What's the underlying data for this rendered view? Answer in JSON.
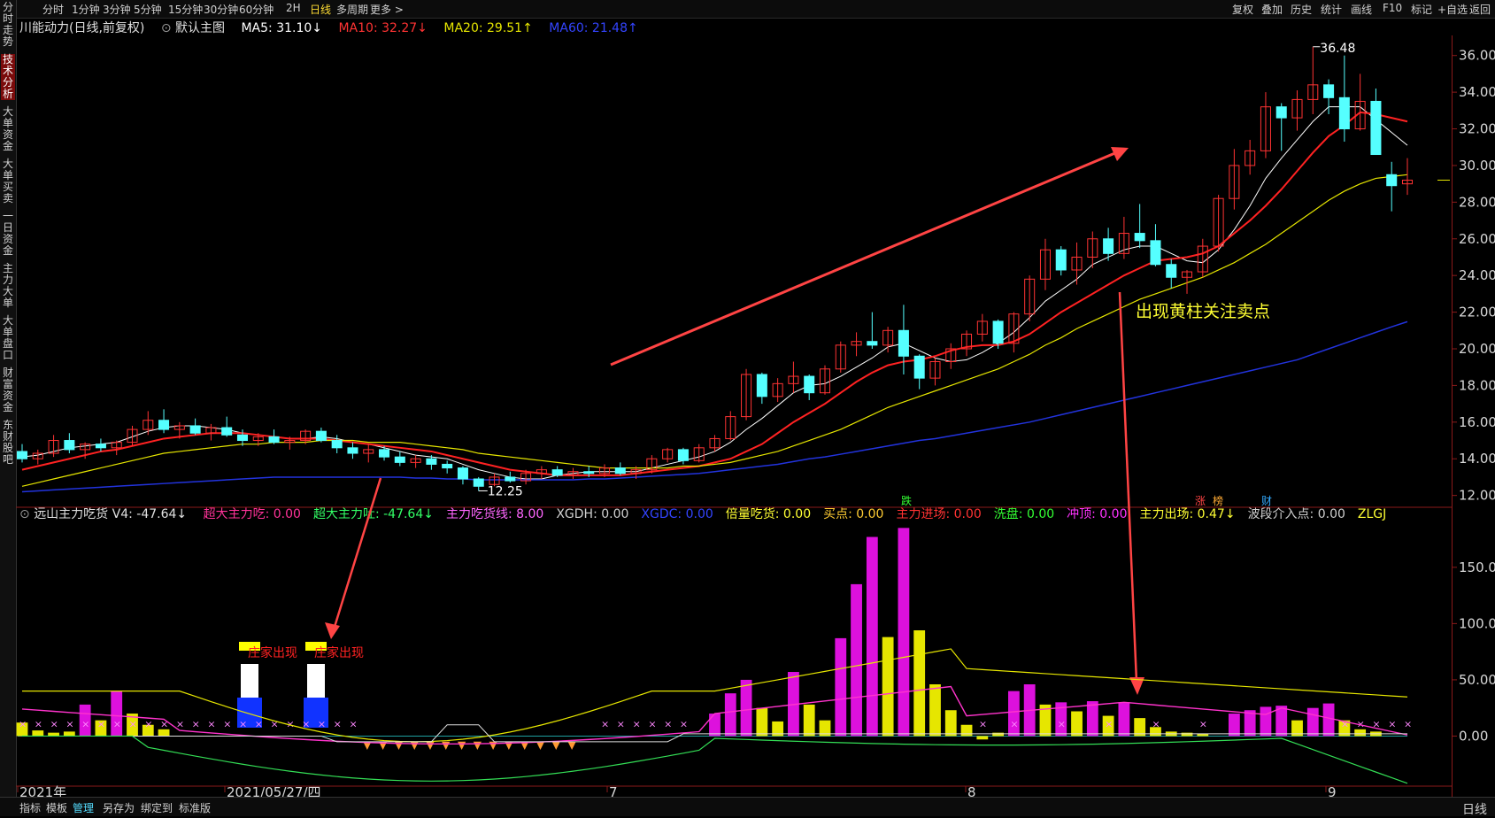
{
  "topbar": {
    "periods": [
      "分时",
      "1分钟",
      "3分钟",
      "5分钟",
      "15分钟",
      "30分钟",
      "60分钟",
      "2H",
      "日线",
      "多周期",
      "更多 >"
    ],
    "active_period": "日线",
    "actions": [
      "复权",
      "叠加",
      "历史",
      "统计",
      "画线",
      "F10",
      "标记",
      "+自选",
      "返回"
    ]
  },
  "sidebar": {
    "tabs": [
      "分时走势",
      "技术分析",
      "大单资金",
      "大单买卖",
      "一日资金",
      "主力大单",
      "大单盘口",
      "财富资金",
      "东财股吧"
    ],
    "active": "技术分析"
  },
  "main_info": {
    "stock": "川能动力(日线,前复权)",
    "template": "默认主图",
    "ma5": "MA5: 31.10↓",
    "ma10": "MA10: 32.27↓",
    "ma20": "MA20: 29.51↑",
    "ma60": "MA60: 21.48↑"
  },
  "sub_info": {
    "name": "远山主力吃货",
    "v4": "V4: -47.64↓",
    "items": [
      {
        "text": "超大主力吃: 0.00",
        "color": "#ff3399"
      },
      {
        "text": "超大主力吐: -47.64↓",
        "color": "#33ff66"
      },
      {
        "text": "主力吃货线: 8.00",
        "color": "#ff66ff"
      },
      {
        "text": "XGDH: 0.00",
        "color": "#d0d0d0"
      },
      {
        "text": "XGDC: 0.00",
        "color": "#3344ff"
      },
      {
        "text": "倍量吃货: 0.00",
        "color": "#ffff33"
      },
      {
        "text": "买点: 0.00",
        "color": "#ffcc33"
      },
      {
        "text": "主力进场: 0.00",
        "color": "#ff3333"
      },
      {
        "text": "洗盘: 0.00",
        "color": "#33ff33"
      },
      {
        "text": "冲顶: 0.00",
        "color": "#ff33ff"
      },
      {
        "text": "主力出场: 0.47↓",
        "color": "#ffff33"
      },
      {
        "text": "波段介入点: 0.00",
        "color": "#d0d0d0"
      },
      {
        "text": "ZLGJ",
        "color": "#ffff33"
      }
    ]
  },
  "bottombar": {
    "items": [
      "指标",
      "模板",
      "管理",
      "另存为",
      "绑定到",
      "标准版"
    ],
    "active": "管理",
    "period": "日线"
  },
  "annotations": {
    "sell_note": "出现黄柱关注卖点",
    "zhuang1": "庄家出现",
    "zhuang2": "庄家出现",
    "high_label": "36.48",
    "low_label": "12.25",
    "marks": [
      "跌",
      "涨",
      "榜",
      "财"
    ]
  },
  "colors": {
    "up": "#ff3333",
    "down": "#55ffff",
    "ma5": "#ffffff",
    "ma10": "#ff2222",
    "ma20": "#e6e600",
    "ma60": "#2233dd",
    "magenta": "#dd11dd",
    "yellow": "#e6e600",
    "accent_red": "#ff4444"
  },
  "chart_data": [
    {
      "type": "candlestick",
      "title": "川能动力(日线,前复权)",
      "xlabel": "",
      "ylabel": "",
      "ylim": [
        11.5,
        37
      ],
      "yticks": [
        "36.00",
        "34.00",
        "32.00",
        "30.00",
        "28.00",
        "26.00",
        "24.00",
        "22.00",
        "20.00",
        "18.00",
        "16.00",
        "14.00",
        "12.00"
      ],
      "x_labels": [
        "2021年",
        "2021/05/27/四",
        "7",
        "8",
        "9"
      ],
      "candles": [
        [
          14.4,
          14.8,
          13.8,
          14.0
        ],
        [
          14.0,
          14.5,
          13.7,
          14.3
        ],
        [
          14.3,
          15.3,
          14.1,
          15.0
        ],
        [
          15.0,
          15.4,
          14.3,
          14.5
        ],
        [
          14.5,
          14.9,
          14.0,
          14.8
        ],
        [
          14.8,
          15.1,
          14.4,
          14.6
        ],
        [
          14.6,
          15.0,
          14.2,
          14.9
        ],
        [
          14.9,
          15.8,
          14.7,
          15.6
        ],
        [
          15.6,
          16.6,
          15.3,
          16.1
        ],
        [
          16.1,
          16.7,
          15.4,
          15.6
        ],
        [
          15.6,
          16.0,
          15.1,
          15.8
        ],
        [
          15.8,
          16.2,
          15.3,
          15.4
        ],
        [
          15.4,
          15.9,
          15.0,
          15.7
        ],
        [
          15.7,
          16.3,
          15.2,
          15.3
        ],
        [
          15.3,
          15.6,
          14.7,
          15.0
        ],
        [
          15.0,
          15.4,
          14.7,
          15.2
        ],
        [
          15.2,
          15.6,
          14.8,
          14.9
        ],
        [
          14.9,
          15.2,
          14.5,
          15.0
        ],
        [
          15.0,
          15.6,
          14.8,
          15.5
        ],
        [
          15.5,
          15.7,
          14.9,
          15.0
        ],
        [
          15.0,
          15.3,
          14.3,
          14.6
        ],
        [
          14.6,
          14.9,
          14.0,
          14.3
        ],
        [
          14.3,
          14.8,
          13.8,
          14.5
        ],
        [
          14.5,
          14.7,
          13.9,
          14.1
        ],
        [
          14.1,
          14.4,
          13.6,
          13.8
        ],
        [
          13.8,
          14.2,
          13.5,
          14.0
        ],
        [
          14.0,
          14.2,
          13.4,
          13.7
        ],
        [
          13.7,
          13.9,
          13.2,
          13.5
        ],
        [
          13.5,
          13.6,
          12.6,
          12.9
        ],
        [
          12.9,
          13.0,
          12.25,
          12.5
        ],
        [
          12.6,
          13.2,
          12.5,
          13.0
        ],
        [
          13.0,
          13.3,
          12.7,
          12.8
        ],
        [
          12.8,
          13.4,
          12.6,
          13.2
        ],
        [
          13.2,
          13.6,
          12.9,
          13.4
        ],
        [
          13.4,
          13.6,
          13.0,
          13.1
        ],
        [
          13.1,
          13.5,
          12.9,
          13.3
        ],
        [
          13.3,
          13.6,
          13.0,
          13.2
        ],
        [
          13.2,
          13.7,
          13.0,
          13.5
        ],
        [
          13.5,
          13.8,
          13.1,
          13.2
        ],
        [
          13.2,
          13.6,
          12.9,
          13.4
        ],
        [
          13.4,
          14.2,
          13.2,
          14.0
        ],
        [
          14.0,
          14.6,
          13.8,
          14.5
        ],
        [
          14.5,
          14.6,
          13.7,
          13.9
        ],
        [
          13.9,
          14.8,
          13.8,
          14.6
        ],
        [
          14.6,
          15.3,
          14.4,
          15.1
        ],
        [
          15.1,
          16.6,
          15.0,
          16.3
        ],
        [
          16.3,
          18.9,
          16.1,
          18.6
        ],
        [
          18.6,
          18.7,
          17.0,
          17.4
        ],
        [
          17.4,
          18.4,
          17.1,
          18.1
        ],
        [
          18.1,
          19.3,
          17.6,
          18.5
        ],
        [
          18.5,
          18.6,
          17.2,
          17.6
        ],
        [
          17.6,
          19.1,
          17.5,
          18.9
        ],
        [
          18.9,
          20.4,
          18.7,
          20.2
        ],
        [
          20.2,
          20.9,
          19.6,
          20.4
        ],
        [
          20.4,
          22.0,
          20.0,
          20.2
        ],
        [
          20.2,
          21.2,
          19.8,
          21.0
        ],
        [
          21.0,
          22.4,
          18.6,
          19.6
        ],
        [
          19.6,
          19.7,
          17.8,
          18.4
        ],
        [
          18.4,
          19.5,
          18.0,
          19.3
        ],
        [
          19.3,
          20.3,
          18.9,
          20.0
        ],
        [
          20.0,
          21.0,
          19.6,
          20.8
        ],
        [
          20.8,
          21.9,
          20.4,
          21.5
        ],
        [
          21.5,
          21.6,
          20.0,
          20.3
        ],
        [
          20.3,
          22.0,
          19.8,
          21.9
        ],
        [
          21.9,
          24.0,
          21.5,
          23.8
        ],
        [
          23.8,
          26.0,
          23.2,
          25.4
        ],
        [
          25.4,
          25.6,
          24.0,
          24.3
        ],
        [
          24.3,
          25.8,
          23.5,
          25.0
        ],
        [
          25.0,
          26.4,
          24.4,
          26.0
        ],
        [
          26.0,
          26.6,
          24.8,
          25.2
        ],
        [
          25.2,
          27.2,
          24.9,
          26.3
        ],
        [
          26.3,
          27.9,
          25.5,
          25.9
        ],
        [
          25.9,
          26.8,
          24.5,
          24.6
        ],
        [
          24.6,
          24.9,
          23.3,
          23.9
        ],
        [
          23.9,
          24.3,
          23.0,
          24.2
        ],
        [
          24.2,
          26.0,
          23.9,
          25.6
        ],
        [
          25.6,
          28.4,
          25.3,
          28.2
        ],
        [
          28.2,
          30.9,
          27.6,
          30.0
        ],
        [
          30.0,
          31.4,
          29.5,
          30.8
        ],
        [
          30.8,
          34.0,
          30.4,
          33.2
        ],
        [
          33.2,
          33.4,
          30.8,
          32.6
        ],
        [
          32.6,
          34.1,
          31.9,
          33.6
        ],
        [
          33.6,
          36.48,
          32.8,
          34.4
        ],
        [
          34.4,
          34.7,
          32.8,
          33.7
        ],
        [
          33.7,
          36.0,
          31.3,
          32.0
        ],
        [
          32.0,
          35.0,
          31.9,
          33.5
        ],
        [
          33.5,
          34.2,
          30.8,
          30.6
        ],
        [
          29.5,
          30.2,
          27.5,
          28.9
        ],
        [
          29.0,
          30.4,
          28.4,
          29.2
        ]
      ],
      "series": [
        {
          "name": "MA5",
          "values": [
            14.1,
            14.2,
            14.4,
            14.6,
            14.7,
            14.8,
            14.9,
            15.2,
            15.5,
            15.7,
            15.8,
            15.8,
            15.7,
            15.6,
            15.4,
            15.3,
            15.2,
            15.1,
            15.1,
            15.2,
            15.1,
            14.9,
            14.8,
            14.6,
            14.4,
            14.2,
            14.1,
            14.0,
            13.7,
            13.4,
            13.2,
            13.0,
            12.9,
            12.9,
            13.1,
            13.2,
            13.3,
            13.3,
            13.3,
            13.3,
            13.5,
            13.7,
            13.9,
            14.1,
            14.4,
            14.9,
            15.6,
            16.2,
            16.9,
            17.6,
            18.0,
            18.1,
            18.5,
            19.0,
            19.5,
            20.1,
            20.3,
            19.9,
            19.5,
            19.3,
            19.4,
            19.8,
            20.3,
            20.9,
            21.7,
            22.6,
            23.2,
            23.8,
            24.6,
            25.0,
            25.4,
            25.6,
            25.6,
            25.2,
            24.8,
            24.7,
            25.4,
            26.5,
            27.8,
            29.3,
            30.4,
            31.4,
            32.4,
            33.2,
            33.2,
            33.2,
            32.5,
            31.8,
            31.1
          ]
        },
        {
          "name": "MA10",
          "values": [
            13.4,
            13.6,
            13.8,
            14.0,
            14.2,
            14.4,
            14.5,
            14.7,
            14.9,
            15.1,
            15.2,
            15.3,
            15.4,
            15.4,
            15.4,
            15.3,
            15.2,
            15.1,
            15.1,
            15.1,
            15.0,
            14.9,
            14.8,
            14.7,
            14.6,
            14.5,
            14.4,
            14.2,
            14.0,
            13.8,
            13.6,
            13.4,
            13.3,
            13.2,
            13.1,
            13.1,
            13.1,
            13.1,
            13.1,
            13.2,
            13.3,
            13.4,
            13.5,
            13.6,
            13.8,
            14.0,
            14.4,
            14.8,
            15.4,
            16.0,
            16.5,
            17.0,
            17.6,
            18.2,
            18.7,
            19.1,
            19.3,
            19.4,
            19.6,
            19.9,
            20.1,
            20.2,
            20.2,
            20.4,
            20.8,
            21.4,
            22.0,
            22.5,
            23.0,
            23.5,
            24.0,
            24.4,
            24.8,
            24.9,
            25.0,
            25.2,
            25.6,
            26.3,
            27.0,
            27.8,
            28.7,
            29.7,
            30.7,
            31.6,
            32.2,
            32.9,
            32.8,
            32.6,
            32.4
          ]
        },
        {
          "name": "MA20",
          "values": [
            12.5,
            12.7,
            12.9,
            13.1,
            13.3,
            13.5,
            13.7,
            13.9,
            14.1,
            14.3,
            14.4,
            14.5,
            14.6,
            14.7,
            14.8,
            14.8,
            14.9,
            14.9,
            14.9,
            15.0,
            15.0,
            15.0,
            14.9,
            14.9,
            14.9,
            14.8,
            14.7,
            14.6,
            14.5,
            14.3,
            14.2,
            14.1,
            14.0,
            13.9,
            13.8,
            13.7,
            13.6,
            13.5,
            13.5,
            13.5,
            13.5,
            13.5,
            13.6,
            13.6,
            13.7,
            13.8,
            14.0,
            14.2,
            14.4,
            14.7,
            15.0,
            15.3,
            15.6,
            16.0,
            16.4,
            16.8,
            17.1,
            17.4,
            17.7,
            18.0,
            18.3,
            18.6,
            18.9,
            19.3,
            19.7,
            20.2,
            20.6,
            21.1,
            21.5,
            21.9,
            22.3,
            22.7,
            23.0,
            23.3,
            23.6,
            23.9,
            24.3,
            24.7,
            25.2,
            25.7,
            26.3,
            26.9,
            27.5,
            28.1,
            28.6,
            29.0,
            29.3,
            29.4,
            29.5
          ]
        },
        {
          "name": "MA60",
          "values": [
            12.2,
            12.25,
            12.3,
            12.35,
            12.4,
            12.45,
            12.5,
            12.55,
            12.6,
            12.65,
            12.7,
            12.75,
            12.8,
            12.85,
            12.9,
            12.95,
            13.0,
            13.0,
            13.0,
            13.0,
            13.0,
            13.0,
            13.0,
            13.0,
            13.0,
            12.95,
            12.95,
            12.9,
            12.9,
            12.85,
            12.85,
            12.85,
            12.85,
            12.85,
            12.85,
            12.85,
            12.9,
            12.9,
            12.95,
            13.0,
            13.05,
            13.1,
            13.15,
            13.2,
            13.3,
            13.4,
            13.5,
            13.6,
            13.7,
            13.85,
            14.0,
            14.1,
            14.25,
            14.4,
            14.55,
            14.7,
            14.85,
            15.0,
            15.1,
            15.25,
            15.4,
            15.55,
            15.7,
            15.85,
            16.0,
            16.2,
            16.4,
            16.6,
            16.8,
            17.0,
            17.2,
            17.4,
            17.6,
            17.8,
            18.0,
            18.2,
            18.4,
            18.6,
            18.8,
            19.0,
            19.2,
            19.4,
            19.7,
            20.0,
            20.3,
            20.6,
            20.9,
            21.2,
            21.48
          ]
        }
      ]
    },
    {
      "type": "bar",
      "title": "远山主力吃货",
      "ylim": [
        -50,
        190
      ],
      "yticks": [
        "150.00",
        "100.00",
        "50.00",
        "0.00"
      ],
      "magenta_bars": [
        0,
        0,
        0,
        0,
        28,
        0,
        40,
        0,
        0,
        0,
        0,
        0,
        0,
        0,
        0,
        0,
        0,
        0,
        0,
        0,
        0,
        0,
        0,
        0,
        0,
        0,
        0,
        0,
        0,
        0,
        0,
        0,
        0,
        0,
        0,
        0,
        0,
        0,
        0,
        0,
        0,
        0,
        0,
        0,
        20,
        38,
        50,
        0,
        0,
        57,
        0,
        0,
        87,
        135,
        177,
        0,
        185,
        0,
        0,
        0,
        0,
        0,
        0,
        40,
        46,
        0,
        30,
        0,
        31,
        0,
        30,
        0,
        0,
        0,
        0,
        0,
        0,
        20,
        23,
        26,
        27,
        0,
        25,
        29,
        0,
        0,
        0,
        0,
        0
      ],
      "yellow_bars": [
        12,
        5,
        3,
        4,
        0,
        14,
        0,
        20,
        10,
        6,
        0,
        0,
        0,
        0,
        0,
        0,
        0,
        0,
        0,
        0,
        0,
        0,
        0,
        0,
        0,
        0,
        0,
        0,
        0,
        0,
        0,
        0,
        0,
        0,
        0,
        0,
        0,
        0,
        0,
        0,
        0,
        0,
        0,
        0,
        0,
        0,
        0,
        25,
        13,
        0,
        28,
        14,
        0,
        0,
        0,
        88,
        0,
        94,
        46,
        23,
        10,
        -3,
        3,
        0,
        0,
        28,
        0,
        22,
        0,
        18,
        0,
        16,
        8,
        4,
        3,
        2,
        0,
        0,
        0,
        0,
        0,
        14,
        0,
        0,
        14,
        6,
        4,
        0,
        0
      ]
    }
  ]
}
